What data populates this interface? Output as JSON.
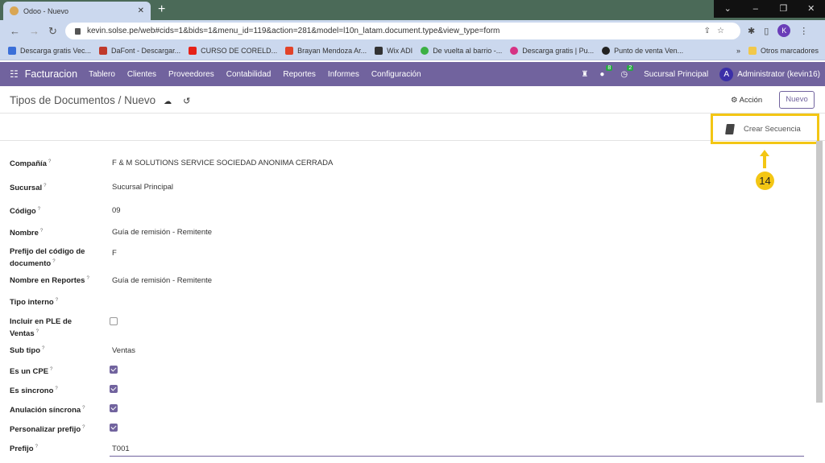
{
  "browser": {
    "tab_title": "Odoo - Nuevo",
    "url": "kevin.solse.pe/web#cids=1&bids=1&menu_id=119&action=281&model=l10n_latam.document.type&view_type=form",
    "profile_initial": "K",
    "bookmarks": [
      {
        "label": "Descarga gratis Vec...",
        "color": "#3b6fd8"
      },
      {
        "label": "DaFont - Descargar...",
        "color": "#c0392b"
      },
      {
        "label": "CURSO DE CORELD...",
        "color": "#e62117"
      },
      {
        "label": "Brayan Mendoza Ar...",
        "color": "#e24329"
      },
      {
        "label": "Wix ADI",
        "color": "#333333"
      },
      {
        "label": "De vuelta al barrio -...",
        "color": "#3cb043"
      },
      {
        "label": "Descarga gratis | Pu...",
        "color": "#d63384"
      },
      {
        "label": "Punto de venta Ven...",
        "color": "#222222"
      }
    ],
    "more": "»",
    "other_bookmarks": "Otros marcadores"
  },
  "navbar": {
    "app": "Facturacion",
    "menu": [
      "Tablero",
      "Clientes",
      "Proveedores",
      "Contabilidad",
      "Reportes",
      "Informes",
      "Configuración"
    ],
    "messages_count": "8",
    "activities_count": "2",
    "branch": "Sucursal Principal",
    "user_initial": "A",
    "user": "Administrator (kevin16)"
  },
  "control": {
    "breadcrumb": "Tipos de Documentos / Nuevo",
    "action_label": "Acción",
    "new_label": "Nuevo"
  },
  "buttons": {
    "create_sequence": "Crear Secuencia"
  },
  "annotation": {
    "step": "14",
    "color": "#f3c614"
  },
  "form": {
    "fields": [
      {
        "label": "Compañía",
        "value": "F & M SOLUTIONS SERVICE SOCIEDAD ANONIMA CERRADA"
      },
      {
        "label": "Sucursal",
        "value": "Sucursal Principal"
      },
      {
        "label": "Código",
        "value": "09"
      },
      {
        "label": "Nombre",
        "value": "Guía de remisión - Remitente"
      },
      {
        "label": "Prefijo del código de documento",
        "value": "F"
      },
      {
        "label": "Nombre en Reportes",
        "value": "Guía de remisión - Remitente"
      },
      {
        "label": "Tipo interno",
        "value": ""
      },
      {
        "label": "Incluir en PLE de Ventas",
        "checked": false
      },
      {
        "label": "Sub tipo",
        "value": "Ventas"
      },
      {
        "label": "Es un CPE",
        "checked": true
      },
      {
        "label": "Es sincrono",
        "checked": true
      },
      {
        "label": "Anulación síncrona",
        "checked": true
      },
      {
        "label": "Personalizar prefijo",
        "checked": true
      },
      {
        "label": "Prefijo",
        "value": "T001"
      }
    ]
  },
  "colors": {
    "brand": "#71639e",
    "highlight": "#f3c614"
  }
}
